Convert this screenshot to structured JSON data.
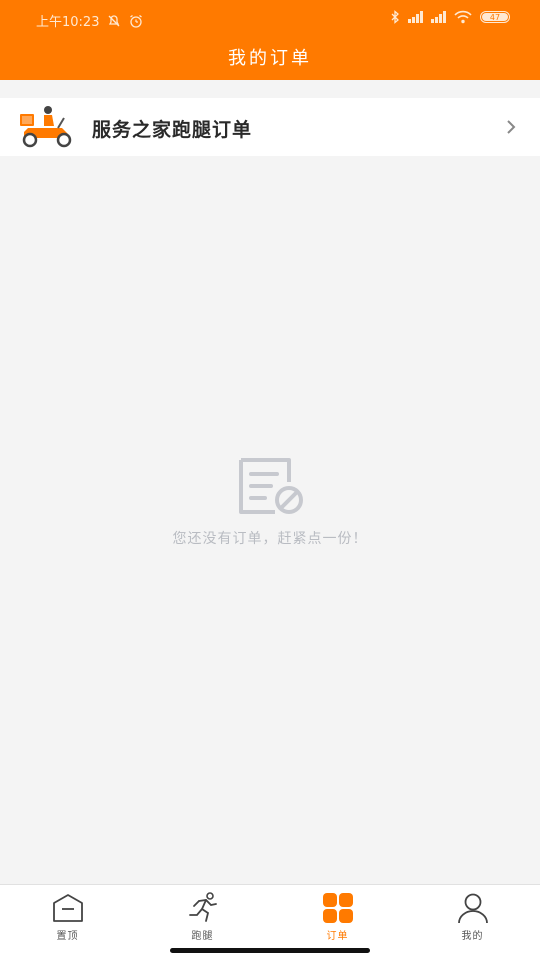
{
  "status_bar": {
    "time": "上午10:23",
    "battery": "47"
  },
  "header": {
    "title": "我的订单"
  },
  "order_card": {
    "title": "服务之家跑腿订单"
  },
  "empty_state": {
    "message": "您还没有订单，赶紧点一份！"
  },
  "bottom_nav": {
    "items": [
      {
        "label": "置顶",
        "icon": "home-icon"
      },
      {
        "label": "跑腿",
        "icon": "runner-icon"
      },
      {
        "label": "订单",
        "icon": "grid-icon",
        "active": true
      },
      {
        "label": "我的",
        "icon": "user-icon"
      }
    ]
  },
  "colors": {
    "brand": "#ff7a00",
    "background": "#f4f4f4",
    "muted_text": "#b9bcc2"
  }
}
